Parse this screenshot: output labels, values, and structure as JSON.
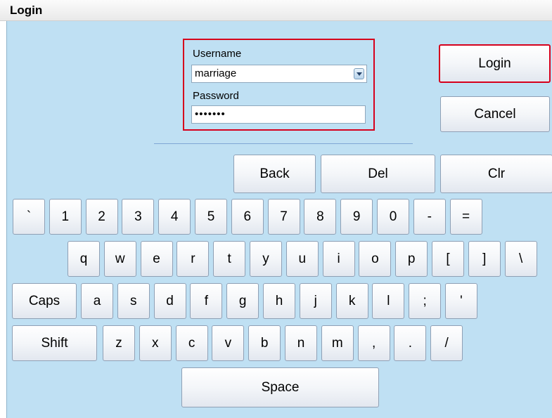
{
  "window": {
    "title": "Login"
  },
  "form": {
    "username_label": "Username",
    "username_value": "marriage",
    "password_label": "Password",
    "password_value": "•••••••"
  },
  "buttons": {
    "login": "Login",
    "cancel": "Cancel"
  },
  "keyboard": {
    "edit_keys": [
      "Back",
      "Del",
      "Clr"
    ],
    "row1": [
      "`",
      "1",
      "2",
      "3",
      "4",
      "5",
      "6",
      "7",
      "8",
      "9",
      "0",
      "-",
      "="
    ],
    "row2": [
      "q",
      "w",
      "e",
      "r",
      "t",
      "y",
      "u",
      "i",
      "o",
      "p",
      "[",
      "]",
      "\\"
    ],
    "row3": [
      "Caps",
      "a",
      "s",
      "d",
      "f",
      "g",
      "h",
      "j",
      "k",
      "l",
      ";",
      "'"
    ],
    "row4": [
      "Shift",
      "z",
      "x",
      "c",
      "v",
      "b",
      "n",
      "m",
      ",",
      ".",
      "/"
    ],
    "space": "Space"
  },
  "colors": {
    "background": "#bfe0f3",
    "highlight": "#d6001c",
    "separator": "#7fa7d4"
  }
}
